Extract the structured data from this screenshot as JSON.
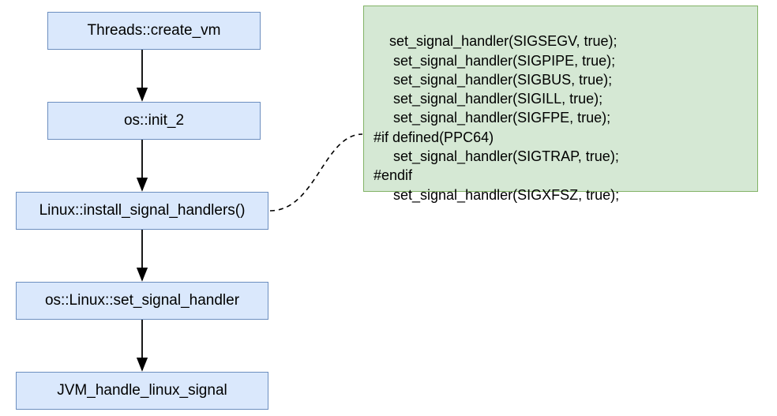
{
  "nodes": {
    "n1": "Threads::create_vm",
    "n2": "os::init_2",
    "n3": "Linux::install_signal_handlers()",
    "n4": "os::Linux::set_signal_handler",
    "n5": "JVM_handle_linux_signal"
  },
  "code": {
    "l1": "    set_signal_handler(SIGSEGV, true);",
    "l2": "     set_signal_handler(SIGPIPE, true);",
    "l3": "     set_signal_handler(SIGBUS, true);",
    "l4": "     set_signal_handler(SIGILL, true);",
    "l5": "     set_signal_handler(SIGFPE, true);",
    "l6": "#if defined(PPC64)",
    "l7": "     set_signal_handler(SIGTRAP, true);",
    "l8": "#endif",
    "l9": "     set_signal_handler(SIGXFSZ, true);"
  }
}
